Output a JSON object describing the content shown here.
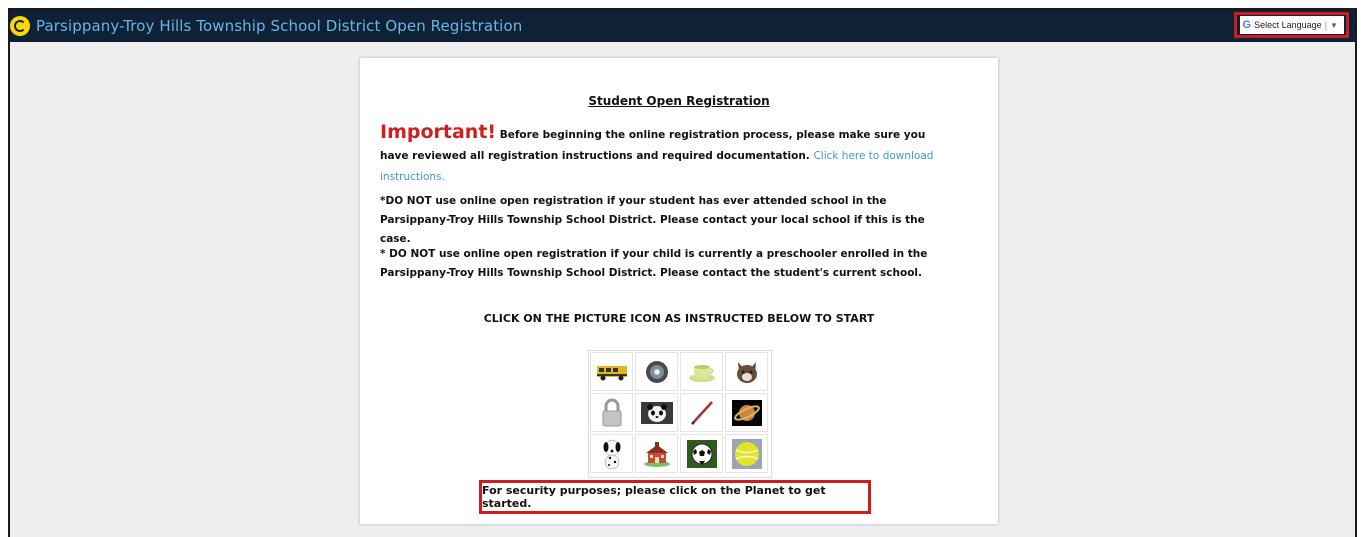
{
  "header": {
    "title": "Parsippany-Troy Hills Township School District Open Registration",
    "language_label": "Select Language",
    "language_caret": "▼",
    "language_sep": "|"
  },
  "card": {
    "title": "Student Open Registration",
    "important_word": "Important!",
    "important_text": " Before beginning the online registration process, please make sure you have reviewed all registration instructions and required documentation. ",
    "download_link": "Click here to download instructions.",
    "note1": "*DO NOT use online open registration if your student has ever attended school in the Parsippany-Troy Hills Township School District. Please contact your local school if this is the case.",
    "note2": "* DO NOT use online open registration if your child is currently a preschooler enrolled in the Parsippany-Troy Hills Township School District. Please contact the student's current school.",
    "instruction_heading": "CLICK ON THE PICTURE ICON AS INSTRUCTED BELOW TO START",
    "security_text": "For security purposes; please click on the Planet to get started."
  },
  "picture_icons": [
    "bus-icon",
    "cd-icon",
    "teacup-icon",
    "cat-icon",
    "padlock-icon",
    "panda-icon",
    "pencil-icon",
    "planet-icon",
    "dalmatian-icon",
    "schoolhouse-icon",
    "soccer-ball-icon",
    "tennis-ball-icon"
  ],
  "colors": {
    "header_bg": "#0e2136",
    "title_color": "#6cb4e6",
    "important_red": "#d11f1f",
    "link_blue": "#3f9ad1",
    "highlight_red": "#d01c1c"
  }
}
